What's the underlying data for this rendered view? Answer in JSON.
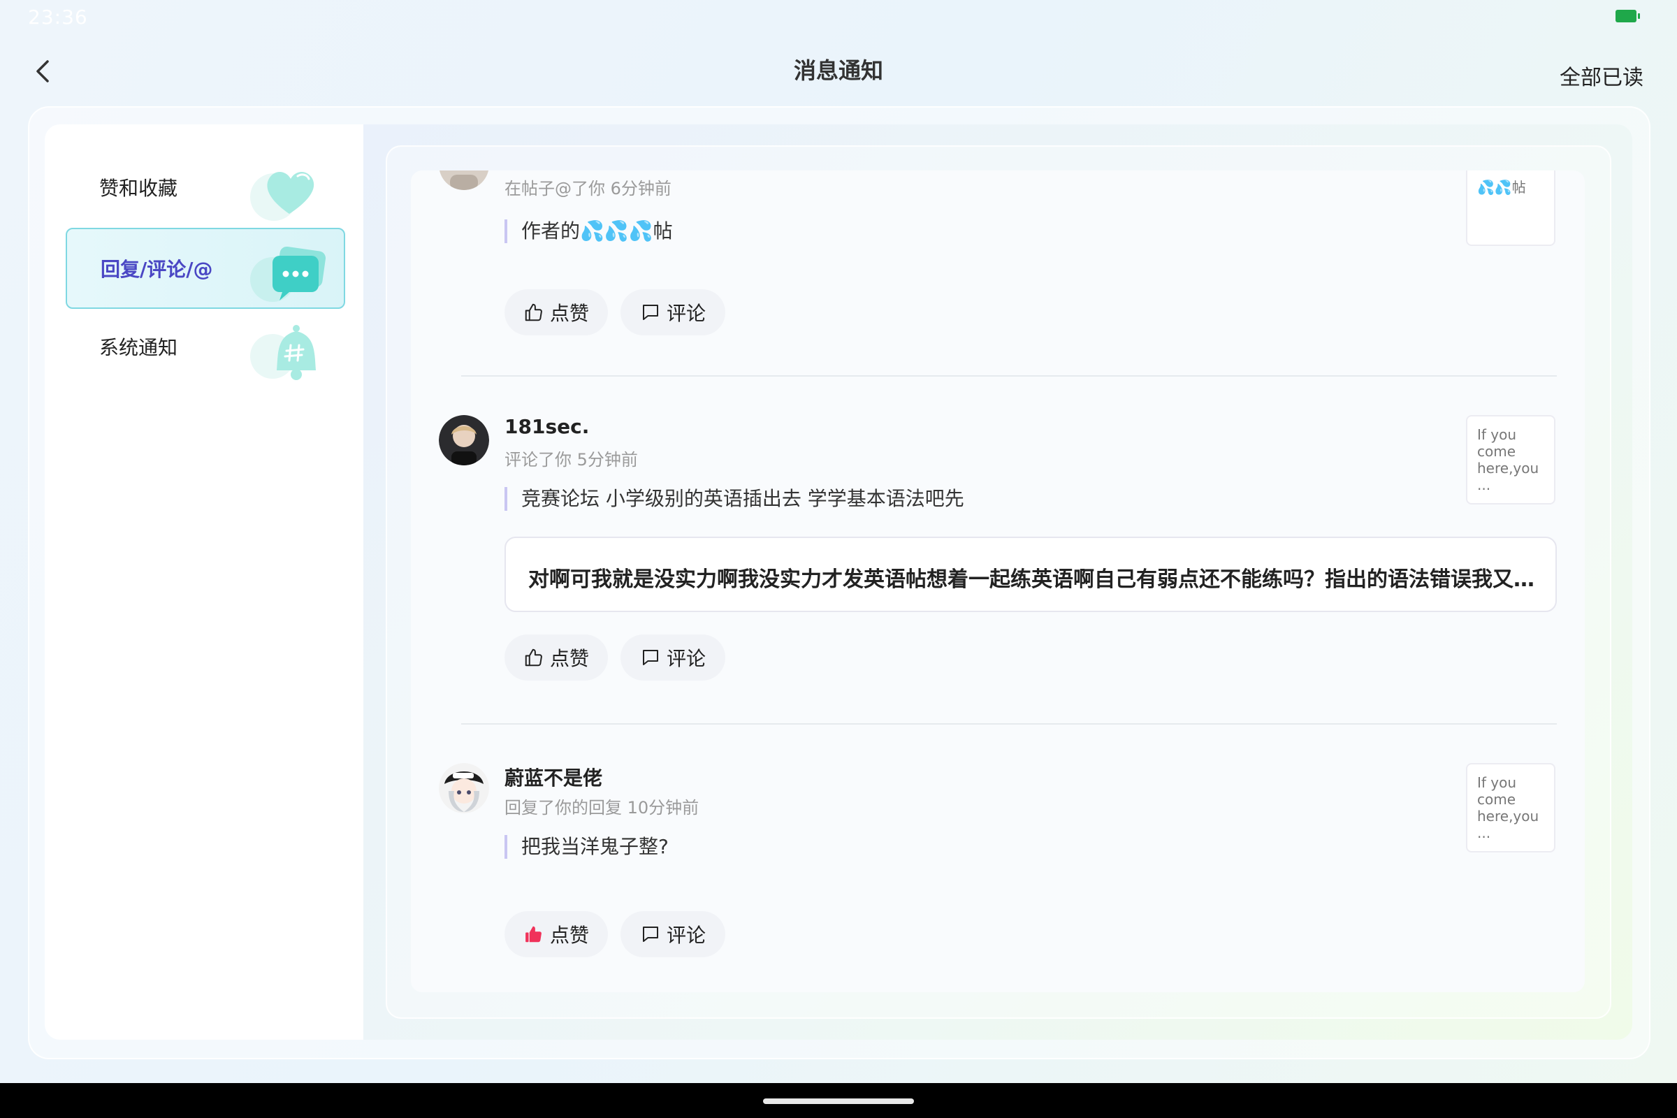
{
  "status_bar": {
    "time": "23:36"
  },
  "header": {
    "title": "消息通知",
    "mark_all_read": "全部已读"
  },
  "sidebar": {
    "items": [
      {
        "label": "赞和收藏",
        "icon": "heart-icon",
        "active": false
      },
      {
        "label": "回复/评论/@",
        "icon": "chat-bubbles-icon",
        "active": true
      },
      {
        "label": "系统通知",
        "icon": "bell-icon",
        "active": false
      }
    ]
  },
  "messages": [
    {
      "username": "",
      "meta": "在帖子@了你 6分钟前",
      "quote": "作者的💦💦💦帖",
      "reply": "",
      "thumbnail_text": "💦💦帖",
      "like_label": "点赞",
      "comment_label": "评论",
      "liked": false
    },
    {
      "username": "181sec.",
      "meta": "评论了你 5分钟前",
      "quote": "竞赛论坛 小学级别的英语插出去  学学基本语法吧先",
      "reply": "对啊可我就是没实力啊我没实力才发英语帖想着一起练英语啊自己有弱点还不能练吗？指出的语法错误我又…",
      "thumbnail_text": "If you come here,you ...",
      "like_label": "点赞",
      "comment_label": "评论",
      "liked": false
    },
    {
      "username": "蔚蓝不是佬",
      "meta": "回复了你的回复 10分钟前",
      "quote": "把我当洋鬼子整?",
      "reply": "",
      "thumbnail_text": "If you come here,you ...",
      "like_label": "点赞",
      "comment_label": "评论",
      "liked": true
    }
  ],
  "colors": {
    "accent": "#4a47c4",
    "active_border": "#7fd8e2",
    "liked": "#f0325a",
    "quote_bar": "#c9c6f2"
  }
}
